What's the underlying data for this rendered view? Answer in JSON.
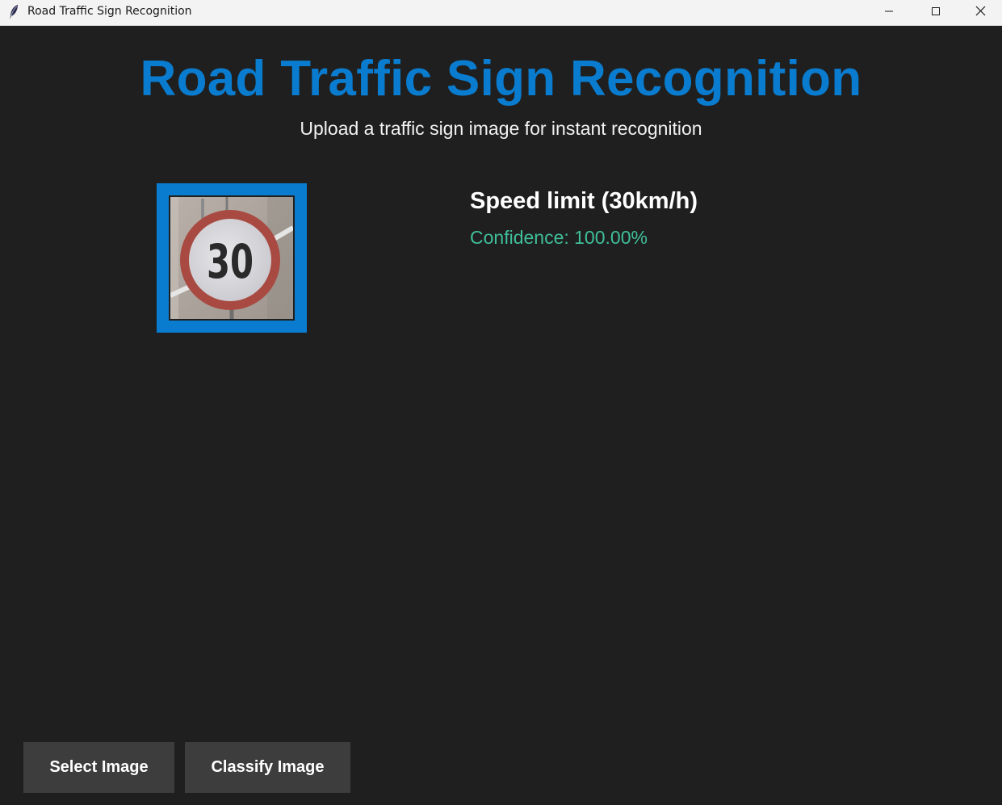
{
  "window": {
    "title": "Road Traffic Sign Recognition",
    "app_icon": "feather-icon",
    "controls": [
      "minimize-icon",
      "maximize-icon",
      "close-icon"
    ]
  },
  "header": {
    "title": "Road Traffic Sign Recognition",
    "subtitle": "Upload a traffic sign image for instant recognition"
  },
  "preview": {
    "sign_number": "30"
  },
  "result": {
    "label": "Speed limit (30km/h)",
    "confidence": "Confidence: 100.00%"
  },
  "buttons": {
    "select_label": "Select Image",
    "classify_label": "Classify Image"
  },
  "colors": {
    "accent": "#0a7ccf",
    "background": "#1f1f1f",
    "confidence": "#3fbf99",
    "button": "#3d3d3d"
  }
}
